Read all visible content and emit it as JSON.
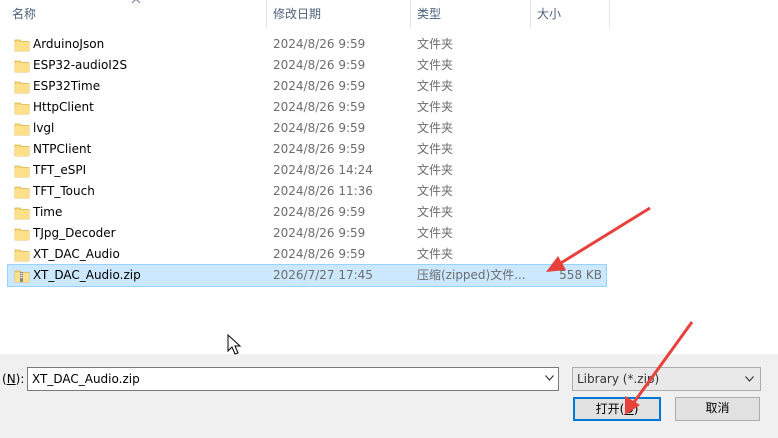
{
  "header": {
    "name_label": "名称",
    "date_label": "修改日期",
    "type_label": "类型",
    "size_label": "大小",
    "sort_icon": "sort-up-chevron"
  },
  "files": [
    {
      "name": "ArduinoJson",
      "date": "2024/8/26 9:59",
      "type": "文件夹",
      "size": "",
      "icon": "folder-icon"
    },
    {
      "name": "ESP32-audioI2S",
      "date": "2024/8/26 9:59",
      "type": "文件夹",
      "size": "",
      "icon": "folder-icon"
    },
    {
      "name": "ESP32Time",
      "date": "2024/8/26 9:59",
      "type": "文件夹",
      "size": "",
      "icon": "folder-icon"
    },
    {
      "name": "HttpClient",
      "date": "2024/8/26 9:59",
      "type": "文件夹",
      "size": "",
      "icon": "folder-icon"
    },
    {
      "name": "lvgl",
      "date": "2024/8/26 9:59",
      "type": "文件夹",
      "size": "",
      "icon": "folder-icon"
    },
    {
      "name": "NTPClient",
      "date": "2024/8/26 9:59",
      "type": "文件夹",
      "size": "",
      "icon": "folder-icon"
    },
    {
      "name": "TFT_eSPI",
      "date": "2024/8/26 14:24",
      "type": "文件夹",
      "size": "",
      "icon": "folder-icon"
    },
    {
      "name": "TFT_Touch",
      "date": "2024/8/26 11:36",
      "type": "文件夹",
      "size": "",
      "icon": "folder-icon"
    },
    {
      "name": "Time",
      "date": "2024/8/26 9:59",
      "type": "文件夹",
      "size": "",
      "icon": "folder-icon"
    },
    {
      "name": "TJpg_Decoder",
      "date": "2024/8/26 9:59",
      "type": "文件夹",
      "size": "",
      "icon": "folder-icon"
    },
    {
      "name": "XT_DAC_Audio",
      "date": "2024/8/26 9:59",
      "type": "文件夹",
      "size": "",
      "icon": "folder-icon"
    },
    {
      "name": "XT_DAC_Audio.zip",
      "date": "2026/7/27 17:45",
      "type": "压缩(zipped)文件...",
      "size": "558 KB",
      "icon": "zip-folder-icon",
      "selected": true
    }
  ],
  "filename": {
    "label": "(N):",
    "label_mnemonic": "N",
    "value": "XT_DAC_Audio.zip"
  },
  "filetype": {
    "value": "Library (*.zip)"
  },
  "buttons": {
    "open": "打开(O)",
    "open_prefix": "打开(",
    "open_mnemonic": "O",
    "open_suffix": ")",
    "cancel": "取消"
  },
  "colors": {
    "selection_bg": "#cce8ff",
    "selection_border": "#99d1ff",
    "primary_button_border": "#0078d7",
    "annotation_arrow": "#e8413c",
    "folder_yellow": "#f8d775"
  }
}
